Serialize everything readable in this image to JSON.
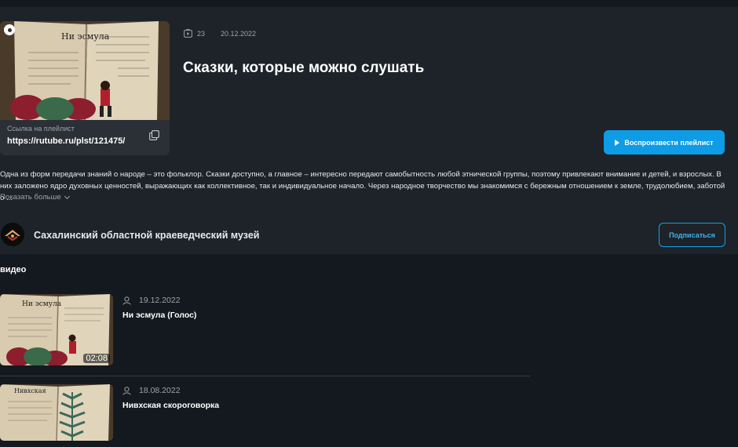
{
  "playlist": {
    "cover_page_heading": "Ни эсмула",
    "cover_icon": "play-badge-icon",
    "link_caption": "Ссылка на плейлист",
    "link_url": "https://rutube.ru/plst/121475/",
    "copy_icon": "copy-icon",
    "video_count": "23",
    "count_icon": "playlist-icon",
    "date": "20.12.2022",
    "title": "Сказки, которые можно слушать",
    "play_label": "Воспроизвести плейлист",
    "description": "Одна из форм передачи знаний о народе – это фольклор. Сказки доступно, а главное – интересно передают самобытность любой этнической группы, поэтому привлекают внимание и детей, и взрослых. В них заложено ядро духовных ценностей, выражающих как коллективное, так и индивидуальное начало. Через народное творчество мы знакомимся с бережным отношением к земле, трудолюбием, заботой о ...",
    "show_more": "Показать больше"
  },
  "channel": {
    "name": "Сахалинский областной краеведческий музей",
    "subscribe_label": "Подписаться"
  },
  "videos_section": {
    "heading": "видео"
  },
  "videos": [
    {
      "date": "19.12.2022",
      "title": "Ни эсмула (Голос)",
      "duration": "02:08",
      "page_heading": "Ни эсмула"
    },
    {
      "date": "18.08.2022",
      "title": "Нивхская скороговорка",
      "page_heading": "Нивхская"
    }
  ],
  "colors": {
    "panel": "#1d2329",
    "background": "#14191f",
    "accent": "#0e9ce6"
  }
}
